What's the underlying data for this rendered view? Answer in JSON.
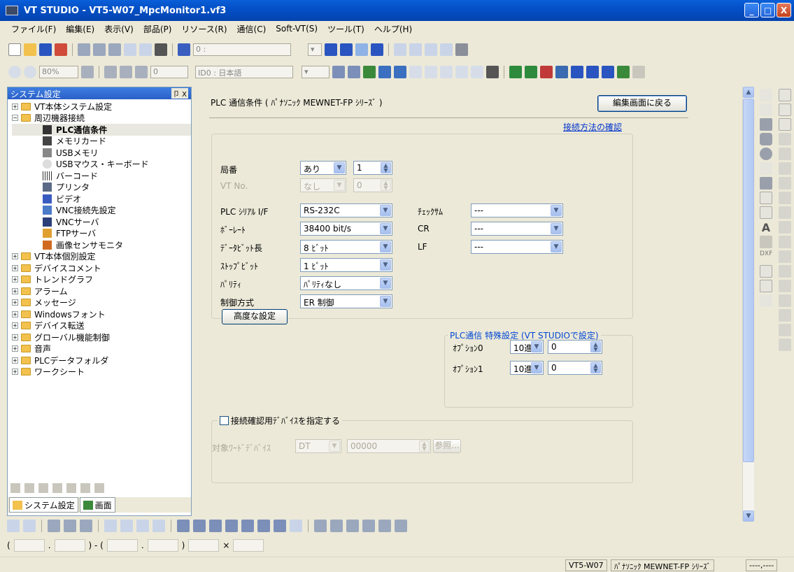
{
  "window": {
    "title": "VT STUDIO - VT5-W07_MpcMonitor1.vf3",
    "controls": [
      "_",
      "□",
      "X"
    ]
  },
  "menu": [
    "ファイル(F)",
    "編集(E)",
    "表示(V)",
    "部品(P)",
    "リソース(R)",
    "通信(C)",
    "Soft-VT(S)",
    "ツール(T)",
    "ヘルプ(H)"
  ],
  "toolbar": {
    "zoom": "80%",
    "coord": "0 :",
    "field_zero": "0",
    "language": "ID0 : 日本語"
  },
  "left_panel": {
    "title": "システム設定",
    "header_buttons": "卩 X",
    "tree": [
      {
        "label": "VT本体システム設定",
        "level": 0,
        "expander": "+"
      },
      {
        "label": "周辺機器接続",
        "level": 0,
        "expander": "-"
      },
      {
        "label": "PLC通信条件",
        "level": 1,
        "selected": true
      },
      {
        "label": "メモリカード",
        "level": 1
      },
      {
        "label": "USBメモリ",
        "level": 1
      },
      {
        "label": "USBマウス・キーボード",
        "level": 1
      },
      {
        "label": "バーコード",
        "level": 1
      },
      {
        "label": "プリンタ",
        "level": 1
      },
      {
        "label": "ビデオ",
        "level": 1
      },
      {
        "label": "VNC接続先設定",
        "level": 1
      },
      {
        "label": "VNCサーバ",
        "level": 1
      },
      {
        "label": "FTPサーバ",
        "level": 1
      },
      {
        "label": "画像センサモニタ",
        "level": 1
      },
      {
        "label": "VT本体個別設定",
        "level": 0,
        "expander": "+"
      },
      {
        "label": "デバイスコメント",
        "level": 0,
        "expander": "+"
      },
      {
        "label": "トレンドグラフ",
        "level": 0,
        "expander": "+"
      },
      {
        "label": "アラーム",
        "level": 0,
        "expander": "+"
      },
      {
        "label": "メッセージ",
        "level": 0,
        "expander": "+"
      },
      {
        "label": "Windowsフォント",
        "level": 0,
        "expander": "+"
      },
      {
        "label": "デバイス転送",
        "level": 0,
        "expander": "+"
      },
      {
        "label": "グローバル機能制御",
        "level": 0,
        "expander": "+"
      },
      {
        "label": "音声",
        "level": 0,
        "expander": "+"
      },
      {
        "label": "PLCデータフォルダ",
        "level": 0,
        "expander": "+"
      },
      {
        "label": "ワークシート",
        "level": 0,
        "expander": "+"
      }
    ],
    "tabs": [
      "システム設定",
      "画面"
    ]
  },
  "content": {
    "title": "PLC 通信条件 ( ﾊﾟﾅｿﾆｯｸ MEWNET-FP ｼﾘｰｽﾞ )",
    "back_button": "編集画面に戻る",
    "check_link": "接続方法の確認",
    "station_label": "局番",
    "station_mode": "あり",
    "station_no": "1",
    "vtno_label": "VT No.",
    "vtno_mode": "なし",
    "vtno_value": "0",
    "plc_if_label": "PLC ｼﾘｱﾙ I/F",
    "plc_if_value": "RS-232C",
    "baud_label": "ﾎﾞｰﾚｰﾄ",
    "baud_value": "38400 bit/s",
    "databit_label": "ﾃﾞｰﾀﾋﾞｯﾄ長",
    "databit_value": "8 ﾋﾞｯﾄ",
    "stopbit_label": "ｽﾄｯﾌﾟﾋﾞｯﾄ",
    "stopbit_value": "1 ﾋﾞｯﾄ",
    "parity_label": "ﾊﾟﾘﾃｨ",
    "parity_value": "ﾊﾟﾘﾃｨなし",
    "control_label": "制御方式",
    "control_value": "ER 制御",
    "checksum_label": "ﾁｪｯｸｻﾑ",
    "checksum_value": "---",
    "cr_label": "CR",
    "cr_value": "---",
    "lf_label": "LF",
    "lf_value": "---",
    "advanced_button": "高度な設定",
    "special_group": "PLC通信 特殊設定 (VT STUDIOで設定)",
    "option0_label": "ｵﾌﾟｼｮﾝ0",
    "option0_base": "10進",
    "option0_value": "0",
    "option1_label": "ｵﾌﾟｼｮﾝ1",
    "option1_base": "10進",
    "option1_value": "0",
    "confirm_group": "接続確認用ﾃﾞﾊﾞｲｽを指定する",
    "target_label": "対象ﾜｰﾄﾞﾃﾞﾊﾞｲｽ",
    "target_device": "DT",
    "target_address": "00000",
    "browse_button": "参照..."
  },
  "bottom_toolbar": {
    "paren_open": "(",
    "paren_mid": ") - (",
    "paren_close": ")",
    "times": "×",
    "dot": "."
  },
  "status": {
    "model": "VT5-W07",
    "plc": "ﾊﾟﾅｿﾆｯｸ MEWNET-FP ｼﾘｰｽﾞ",
    "extra": "----,----"
  }
}
